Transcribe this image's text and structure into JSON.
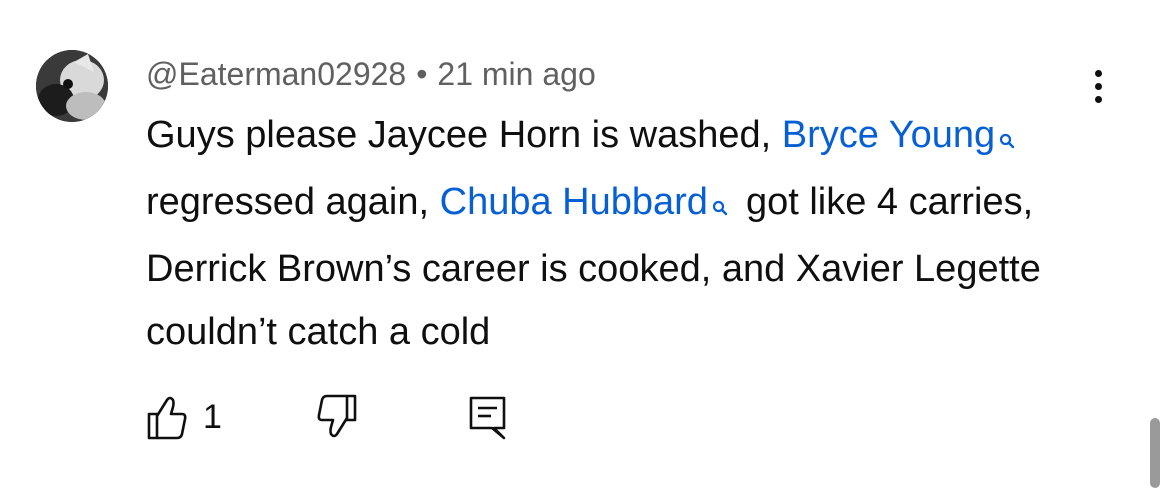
{
  "comment": {
    "author": "@Eaterman02928",
    "separator": "•",
    "time": "21 min ago",
    "text_parts": {
      "p1": "Guys please Jaycee Horn is washed, ",
      "link1": "Bryce Young",
      "p2": "regressed again, ",
      "link2": "Chuba Hubbard",
      "p3": "got like 4 carries, Derrick Brown’s career is cooked, and Xavier Legette couldn’t catch a cold"
    },
    "like_count": "1"
  },
  "colors": {
    "link": "#065fd4",
    "meta_text": "#606060",
    "body_text": "#0f0f0f"
  },
  "icons": [
    "avatar",
    "more-vert-icon",
    "search-icon",
    "thumb-up-icon",
    "thumb-down-icon",
    "reply-comment-icon"
  ]
}
